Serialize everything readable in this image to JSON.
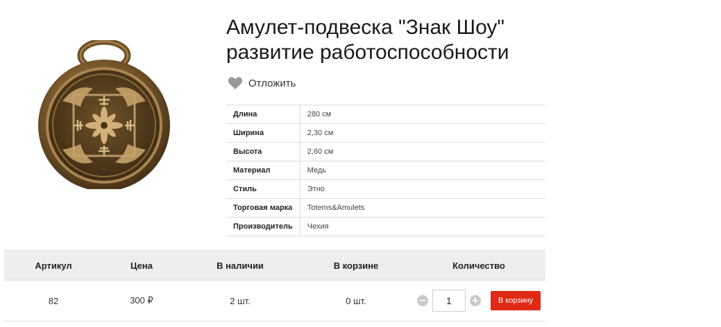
{
  "product": {
    "title_line1": "Амулет-подвеска \"Знак Шоу\"",
    "title_line2": "развитие работоспособности",
    "image_icon": "amulet-pendant-image",
    "accent_color": "#e02a16"
  },
  "favorite": {
    "label": "Отложить",
    "icon": "heart-icon"
  },
  "properties": [
    {
      "name": "Длина",
      "value": "280 см"
    },
    {
      "name": "Ширина",
      "value": "2,30 см"
    },
    {
      "name": "Высота",
      "value": "2,60 см"
    },
    {
      "name": "Материал",
      "value": "Медь"
    },
    {
      "name": "Стиль",
      "value": "Этно"
    },
    {
      "name": "Торговая марка",
      "value": "Totems&Amulets"
    },
    {
      "name": "Производитель",
      "value": "Чехия"
    }
  ],
  "offers": {
    "headers": {
      "article": "Артикул",
      "price": "Цена",
      "stock": "В наличии",
      "in_cart": "В корзине",
      "quantity": "Количество"
    },
    "row": {
      "article": "82",
      "price": "300 ₽",
      "stock": "2 шт.",
      "in_cart": "0 шт.",
      "quantity": "1"
    },
    "minus": "−",
    "plus": "+",
    "cart_button": "В корзину"
  }
}
